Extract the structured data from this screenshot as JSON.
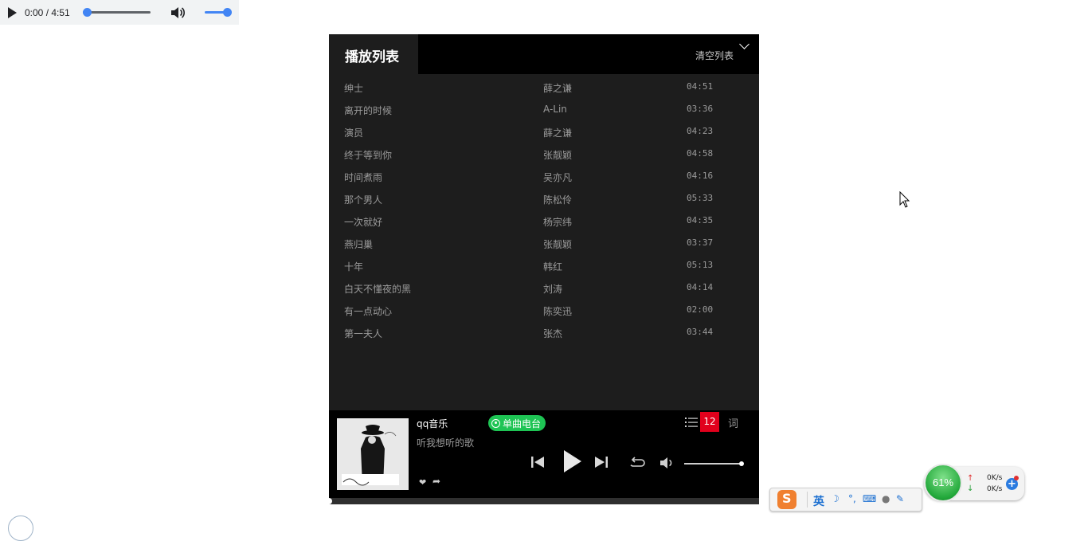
{
  "audio": {
    "time": "0:00 / 4:51",
    "play_icon": "play-icon",
    "volume_icon": "speaker-icon"
  },
  "player": {
    "playlist_title": "播放列表",
    "clear_label": "清空列表",
    "collapse_icon": "chevron-down-icon",
    "songs": [
      {
        "title": "绅士",
        "artist": "薛之谦",
        "duration": "04:51"
      },
      {
        "title": "离开的时候",
        "artist": "A-Lin",
        "duration": "03:36"
      },
      {
        "title": "演员",
        "artist": "薛之谦",
        "duration": "04:23"
      },
      {
        "title": "终于等到你",
        "artist": "张靓颖",
        "duration": "04:58"
      },
      {
        "title": "时间煮雨",
        "artist": "吴亦凡",
        "duration": "04:16"
      },
      {
        "title": "那个男人",
        "artist": "陈松伶",
        "duration": "05:33"
      },
      {
        "title": "一次就好",
        "artist": "杨宗纬",
        "duration": "04:35"
      },
      {
        "title": "燕归巢",
        "artist": "张靓颖",
        "duration": "03:37"
      },
      {
        "title": "十年",
        "artist": "韩红",
        "duration": "05:13"
      },
      {
        "title": "白天不懂夜的黑",
        "artist": "刘涛",
        "duration": "04:14"
      },
      {
        "title": "有一点动心",
        "artist": "陈奕迅",
        "duration": "02:00"
      },
      {
        "title": "第一夫人",
        "artist": "张杰",
        "duration": "03:44"
      }
    ],
    "now_playing": {
      "name": "qq音乐",
      "subtitle": "听我想听的歌",
      "radio_label": "单曲电台"
    },
    "playlist_count": "12",
    "lyric_label": "词",
    "volume_fraction": 1.0,
    "progress_fraction": 0.0,
    "accent_color": "#1ec454",
    "badge_color": "#e1001c"
  },
  "ime": {
    "lang": "英",
    "logo_text": "S"
  },
  "net_monitor": {
    "percent": "61%",
    "up": "0K/s",
    "down": "0K/s"
  }
}
